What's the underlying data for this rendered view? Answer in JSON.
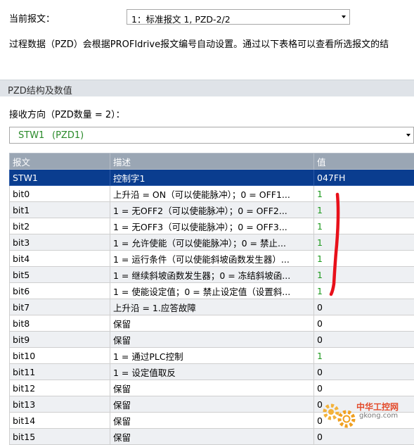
{
  "header": {
    "telegram_label": "当前报文：",
    "telegram_value": "1：标准报文 1, PZD-2/2",
    "info_text": "过程数据（PZD）会根据PROFIdrive报文编号自动设置。通过以下表格可以查看所选报文的结"
  },
  "section": {
    "title": "PZD结构及数值",
    "receive_label": "接收方向（PZD数量 = 2）：",
    "pzd_select_name": "STW1",
    "pzd_select_sub": "(PZD1)"
  },
  "table": {
    "columns": [
      "报文",
      "描述",
      "值"
    ],
    "rows": [
      {
        "signal": "STW1",
        "desc": "控制字1",
        "value": "047FH",
        "selected": true
      },
      {
        "signal": "bit0",
        "desc": "上升沿 = ON（可以使能脉冲）；0 = OFF1...",
        "value": "1"
      },
      {
        "signal": "bit1",
        "desc": "1 = 无OFF2（可以使能脉冲）；0 = OFF2...",
        "value": "1"
      },
      {
        "signal": "bit2",
        "desc": "1 = 无OFF3（可以使能脉冲）；0 = OFF3...",
        "value": "1"
      },
      {
        "signal": "bit3",
        "desc": "1 = 允许使能（可以使能脉冲）；0 = 禁止...",
        "value": "1"
      },
      {
        "signal": "bit4",
        "desc": "1 = 运行条件（可以使能斜坡函数发生器）...",
        "value": "1"
      },
      {
        "signal": "bit5",
        "desc": "1 = 继续斜坡函数发生器；0 = 冻结斜坡函...",
        "value": "1"
      },
      {
        "signal": "bit6",
        "desc": "1 = 使能设定值；0 = 禁止设定值（设置斜...",
        "value": "1"
      },
      {
        "signal": "bit7",
        "desc": "上升沿 = 1.应答故障",
        "value": "0"
      },
      {
        "signal": "bit8",
        "desc": "保留",
        "value": "0"
      },
      {
        "signal": "bit9",
        "desc": "保留",
        "value": "0"
      },
      {
        "signal": "bit10",
        "desc": "1 = 通过PLC控制",
        "value": "1"
      },
      {
        "signal": "bit11",
        "desc": "1 = 设定值取反",
        "value": "0"
      },
      {
        "signal": "bit12",
        "desc": "保留",
        "value": "0"
      },
      {
        "signal": "bit13",
        "desc": "保留",
        "value": "0"
      },
      {
        "signal": "bit14",
        "desc": "保留",
        "value": "0"
      },
      {
        "signal": "bit15",
        "desc": "保留",
        "value": "0"
      }
    ]
  },
  "watermark": {
    "logo_text": "中华工控网",
    "domain_text": "gkong.com"
  },
  "colors": {
    "header_bg": "#9aa6b4",
    "selected_row": "#0a3d8f",
    "value_one": "#1e9a1e",
    "annotation": "#e8101a"
  },
  "icons": [
    "chevron-down-icon",
    "gear-logo-icon"
  ]
}
